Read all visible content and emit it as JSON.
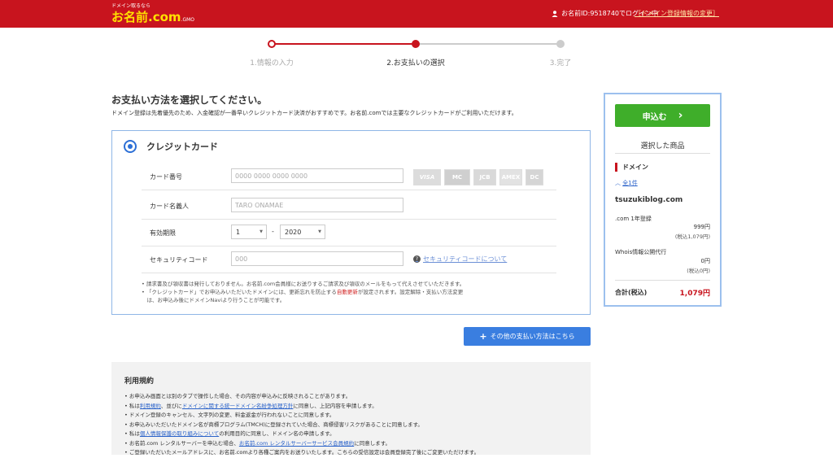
{
  "header": {
    "tagline": "ドメイン取るなら",
    "brand": "お名前.com",
    "brand_suffix": ".GMO",
    "user_info": "お名前ID:9518740でログイン中",
    "user_link": "［ドメイン登録情報の変更］"
  },
  "steps": [
    {
      "label": "1.情報の入力",
      "state": "done"
    },
    {
      "label": "2.お支払いの選択",
      "state": "current"
    },
    {
      "label": "3.完了",
      "state": "todo"
    }
  ],
  "colors": {
    "brand_red": "#c8141e",
    "accent_blue": "#3a7ee0",
    "apply_green": "#3fae2a"
  },
  "main": {
    "title": "お支払い方法を選択してください。",
    "subtext": "ドメイン登録は先着優先のため、入金確認が一番早いクレジットカード決済がおすすめです。お名前.comでは主要なクレジットカードがご利用いただけます。"
  },
  "credit": {
    "title": "クレジットカード",
    "card_number_label": "カード番号",
    "card_number_placeholder": "0000 0000 0000 0000",
    "card_holder_label": "カード名義人",
    "card_holder_placeholder": "TARO ONAMAE",
    "expiry_label": "有効期限",
    "expiry_month": "1",
    "expiry_sep": "-",
    "expiry_year": "2020",
    "security_label": "セキュリティコード",
    "security_placeholder": "000",
    "security_help": "セキュリティコードについて",
    "card_brands": [
      "VISA",
      "MC",
      "JCB",
      "AMEX",
      "DC"
    ],
    "note1": "• 請求書及び領収書は発行しておりません。お名前.com会員様にお送りするご請求及び領収のメールをもって代えさせていただきます。",
    "note2a": "• 「クレジットカード」でお申込みいただいたドメインには、更新忘れを防止する",
    "note2_red": "自動更新",
    "note2b": "が設定されます。設定解除・支払い方法変更",
    "note3": "　は、お申込み後にドメインNaviより行うことが可能です。"
  },
  "other_payment": "その他の支払い方法はこちら",
  "terms": {
    "title": "利用規約",
    "line1": "• お申込み画面とは別のタブで操作した場合、その内容が申込みに反映されることがあります。",
    "line2a": "• 私は",
    "line2_link1": "利用規約",
    "line2b": "、並びに",
    "line2_link2": "ドメインに関する統一ドメイン名紛争処理方針",
    "line2c": "に同意し、上記内容を申請します。",
    "line3": "• ドメイン登録のキャンセル、文字列の変更、料金返金が行われないことに同意します。",
    "line4": "• お申込みいただいたドメイン名が商標プログラム(TMCH)に登録されていた場合、商標侵害リスクがあることに同意します。",
    "line5a": "• 私は",
    "line5_link": "個人情報保護の取り組みについて",
    "line5b": "の利用目的に同意し、ドメイン名の申請します。",
    "line6a": "• お名前.com レンタルサーバーを申込む場合、",
    "line6_link": "お名前.com レンタルサーバーサービス会員規約",
    "line6b": "に同意します。",
    "line7": "• ご登録いただいたメールアドレスに、お名前.comより各種ご案内をお送りいたします。こちらの受信設定は会員登録完了後にご変更いただけます。"
  },
  "sidebar": {
    "apply_label": "申込む",
    "apply_arrow": "›",
    "selected_title": "選択した商品",
    "domain_heading": "ドメイン",
    "all_prefix": "︿",
    "all_link": "全1件",
    "domain_name": "tsuzukiblog.com",
    "item1_label": ".com 1年登録",
    "item1_price": "999円",
    "item1_tax": "(税込1,079円)",
    "item2_label": "Whois情報公開代行",
    "item2_price": "0円",
    "item2_tax": "(税込0円)",
    "total_label": "合計(税込)",
    "total_value": "1,079円"
  }
}
